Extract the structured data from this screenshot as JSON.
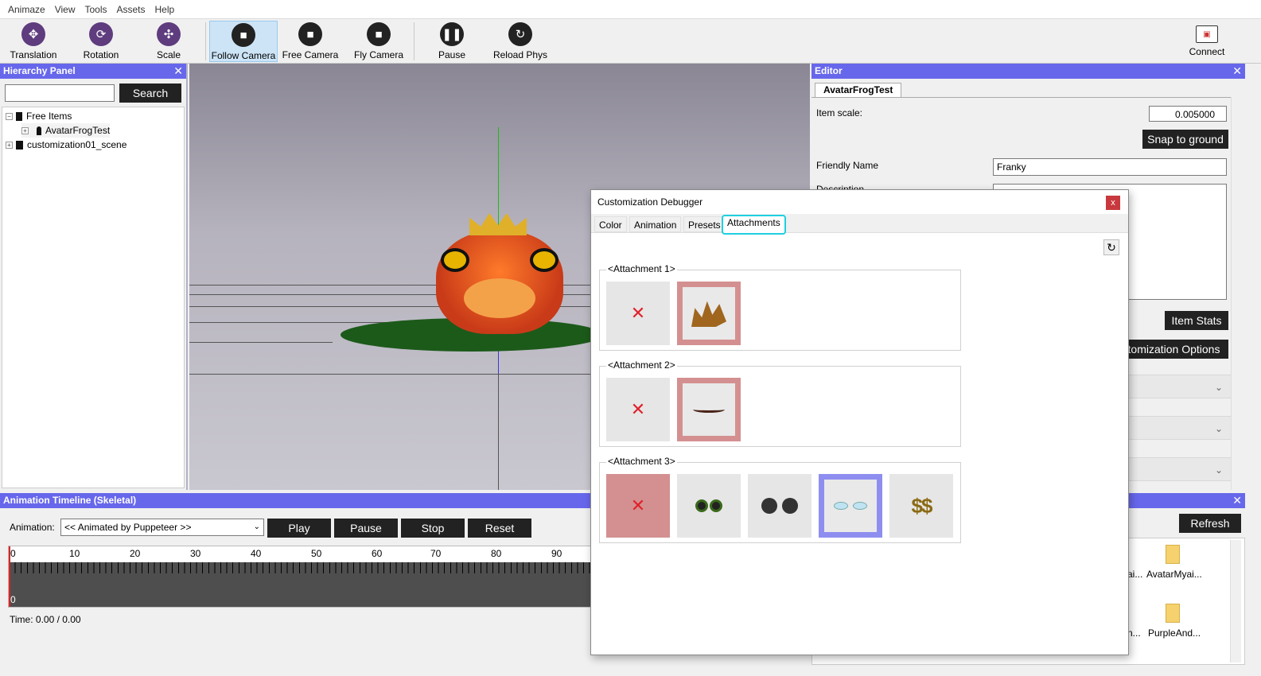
{
  "menubar": {
    "items": [
      "Animaze",
      "View",
      "Tools",
      "Assets",
      "Help"
    ]
  },
  "toolbar": {
    "buttons": [
      "Translation",
      "Rotation",
      "Scale",
      "Follow Camera",
      "Free Camera",
      "Fly Camera",
      "Pause",
      "Reload Phys",
      "Connect"
    ]
  },
  "hierarchy": {
    "title": "Hierarchy Panel",
    "search_label": "Search",
    "search_value": "",
    "tree": [
      "Free Items",
      "AvatarFrogTest",
      "customization01_scene"
    ]
  },
  "editor": {
    "title": "Editor",
    "tab": "AvatarFrogTest",
    "item_scale_label": "Item scale:",
    "item_scale_value": "0.005000",
    "snap_button": "Snap to ground",
    "friendly_name_label": "Friendly Name",
    "friendly_name_value": "Franky",
    "description_label": "Description",
    "item_stats_button": "Item Stats",
    "customization_button": "stomization Options"
  },
  "timeline": {
    "title": "Animation Timeline (Skeletal)",
    "animation_label": "Animation:",
    "animation_value": "<< Animated by Puppeteer >>",
    "buttons": [
      "Play",
      "Pause",
      "Stop",
      "Reset"
    ],
    "ticks": [
      "0",
      "10",
      "20",
      "30",
      "40",
      "50",
      "60",
      "70",
      "80",
      "90"
    ],
    "zero_bottom": "0",
    "time": "Time: 0.00 / 0.00"
  },
  "assets": {
    "refresh_button": "Refresh",
    "items": [
      "ai...",
      "AvatarMyai...",
      "n...",
      "PurpleAnd..."
    ]
  },
  "dialog": {
    "title": "Customization Debugger",
    "close": "x",
    "tabs": [
      "Color",
      "Animation",
      "Presets",
      "Attachments"
    ],
    "selected_tab": "Attachments",
    "groups": [
      {
        "label": "<Attachment 1>",
        "slots": [
          "none",
          "crown"
        ],
        "selected": 1
      },
      {
        "label": "<Attachment 2>",
        "slots": [
          "none",
          "mustache"
        ],
        "selected": 1
      },
      {
        "label": "<Attachment 3>",
        "slots": [
          "none",
          "frog-glasses",
          "round-sunglasses",
          "rimless-glasses",
          "dollar-glasses"
        ],
        "selected": 0,
        "hovered": 3
      }
    ]
  }
}
